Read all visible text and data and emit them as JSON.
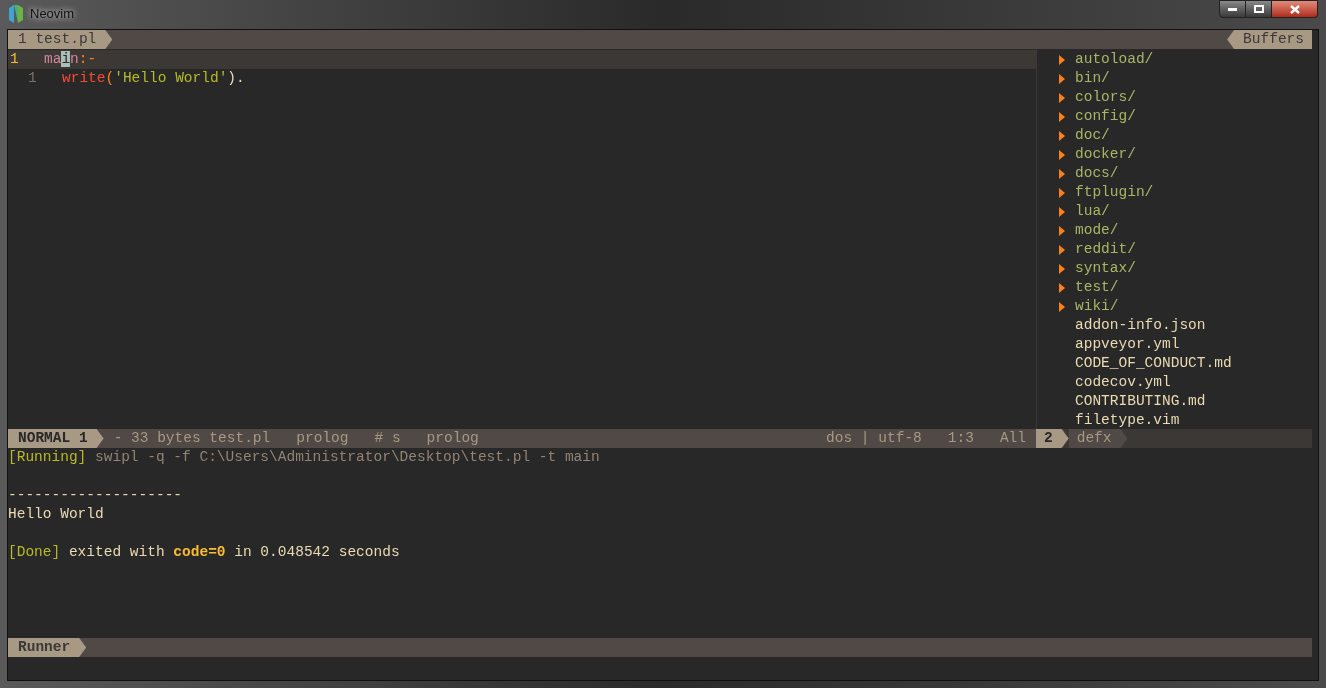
{
  "window": {
    "title": "Neovim"
  },
  "tabline": {
    "buffers": [
      {
        "label": "1 test.pl",
        "selected": true
      }
    ],
    "right_label": "Buffers"
  },
  "editor": {
    "lines": [
      {
        "number": "1",
        "current": true,
        "tokens": [
          {
            "text": "ma",
            "kind": "head"
          },
          {
            "text": "i",
            "kind": "cursor"
          },
          {
            "text": "n",
            "kind": "head"
          },
          {
            "text": ":-",
            "kind": "operator"
          }
        ]
      },
      {
        "number": "1",
        "current": false,
        "tokens": [
          {
            "text": "write",
            "kind": "builtin"
          },
          {
            "text": "(",
            "kind": "operator"
          },
          {
            "text": "'Hello World'",
            "kind": "string"
          },
          {
            "text": ").",
            "kind": "plain"
          }
        ]
      }
    ]
  },
  "file_tree": {
    "items": [
      {
        "name": "autoload/",
        "kind": "dir"
      },
      {
        "name": "bin/",
        "kind": "dir"
      },
      {
        "name": "colors/",
        "kind": "dir"
      },
      {
        "name": "config/",
        "kind": "dir"
      },
      {
        "name": "doc/",
        "kind": "dir"
      },
      {
        "name": "docker/",
        "kind": "dir"
      },
      {
        "name": "docs/",
        "kind": "dir"
      },
      {
        "name": "ftplugin/",
        "kind": "dir"
      },
      {
        "name": "lua/",
        "kind": "dir"
      },
      {
        "name": "mode/",
        "kind": "dir"
      },
      {
        "name": "reddit/",
        "kind": "dir"
      },
      {
        "name": "syntax/",
        "kind": "dir"
      },
      {
        "name": "test/",
        "kind": "dir"
      },
      {
        "name": "wiki/",
        "kind": "dir"
      },
      {
        "name": "addon-info.json",
        "kind": "file"
      },
      {
        "name": "appveyor.yml",
        "kind": "file"
      },
      {
        "name": "CODE_OF_CONDUCT.md",
        "kind": "file"
      },
      {
        "name": "codecov.yml",
        "kind": "file"
      },
      {
        "name": "CONTRIBUTING.md",
        "kind": "file"
      },
      {
        "name": "filetype.vim",
        "kind": "file"
      }
    ]
  },
  "status_line": {
    "mode": "NORMAL 1",
    "left": [
      "- 33 bytes test.pl",
      "prolog",
      "# s",
      "prolog"
    ],
    "right": [
      "dos | utf-8",
      "1:3",
      "All"
    ],
    "tree_number": "2",
    "tree_name": "defx"
  },
  "terminal": {
    "lines": [
      {
        "kind": "text",
        "parts": [
          {
            "text": "[Running]",
            "kind": "tag"
          },
          {
            "text": " swipl -q -f C:\\Users\\Administrator\\Desktop\\test.pl -t main",
            "kind": "dim"
          }
        ]
      },
      {
        "kind": "gap"
      },
      {
        "kind": "text",
        "parts": [
          {
            "text": "--------------------",
            "kind": "plain"
          }
        ]
      },
      {
        "kind": "text",
        "parts": [
          {
            "text": "Hello World",
            "kind": "plain"
          }
        ]
      },
      {
        "kind": "gap"
      },
      {
        "kind": "text",
        "parts": [
          {
            "text": "[Done]",
            "kind": "tag"
          },
          {
            "text": " exited with ",
            "kind": "plain"
          },
          {
            "text": "code=0",
            "kind": "bold"
          },
          {
            "text": " in 0.048542 seconds",
            "kind": "plain"
          }
        ]
      }
    ]
  },
  "runner_bar": {
    "label": "Runner"
  }
}
